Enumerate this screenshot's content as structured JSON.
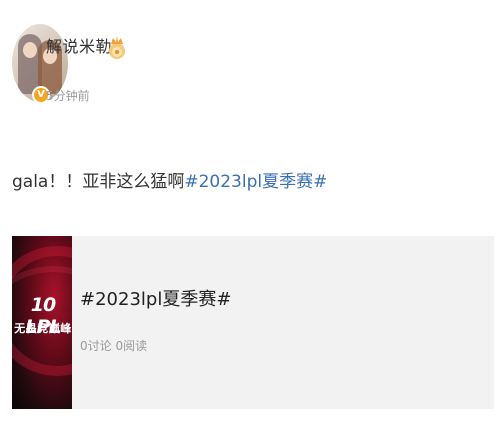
{
  "post": {
    "author": {
      "username": "解说米勒",
      "avatar_icon": "avatar-photo",
      "verified_icon": "verified-badge-icon",
      "badge_icon": "crown-icon",
      "verified_color": "#f4a622"
    },
    "timestamp": "5分钟前",
    "text": "gala！！亚非这么猛啊",
    "hashtag": "#2023lpl夏季赛#",
    "hashtag_color": "#3b6fb6"
  },
  "card": {
    "thumbnail": {
      "logo_text": "10 LPL",
      "subtitle": "无畏竞巅峰"
    },
    "title": "#2023lpl夏季赛#",
    "stats": "0讨论 0阅读",
    "background": "#f2f2f2"
  }
}
